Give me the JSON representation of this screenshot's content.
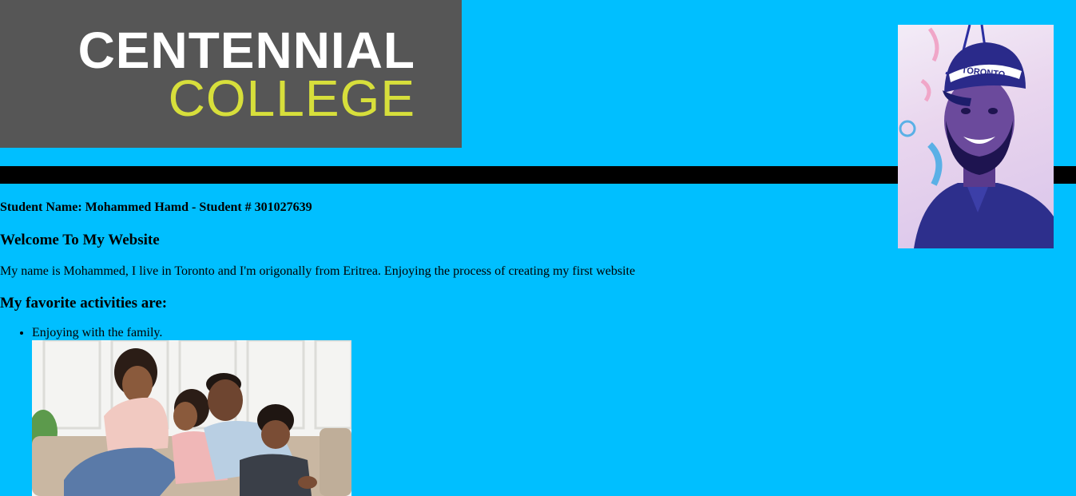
{
  "logo": {
    "line1": "CENTENNIAL",
    "line2": "COLLEGE",
    "colors": {
      "background": "#565656",
      "line1": "#ffffff",
      "line2": "#d7df3b"
    }
  },
  "theme": {
    "page_background": "#00bfff",
    "divider": "#000000"
  },
  "profile_photo": {
    "cap_text": "TORONTO"
  },
  "content": {
    "student_line": "Student Name: Mohammed Hamd - Student # 301027639",
    "welcome_heading": "Welcome To My Website",
    "intro_paragraph": "My name is Mohammed, I live in Toronto and I'm origonally from Eritrea. Enjoying the process of creating my first website",
    "activities_heading": "My favorite activities are:",
    "activities": [
      {
        "label": "Enjoying with the family."
      }
    ]
  }
}
